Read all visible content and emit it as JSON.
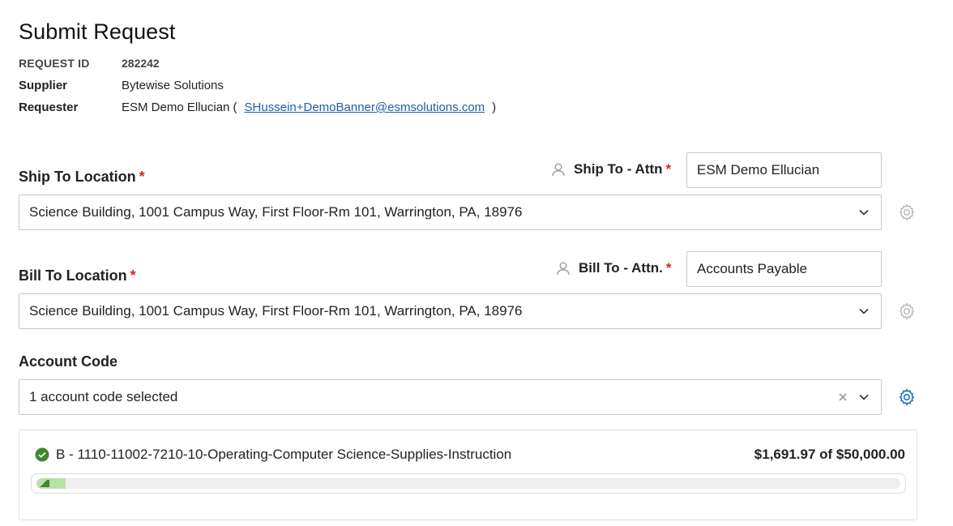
{
  "page": {
    "title": "Submit Request"
  },
  "meta": {
    "request_id_label": "REQUEST ID",
    "request_id_value": "282242",
    "supplier_label": "Supplier",
    "supplier_value": "Bytewise Solutions",
    "requester_label": "Requester",
    "requester_name_prefix": "ESM Demo Ellucian (",
    "requester_email": "SHussein+DemoBanner@esmsolutions.com",
    "requester_suffix": ")"
  },
  "ship_to": {
    "label": "Ship To Location",
    "required_mark": "*",
    "attn_label": "Ship To - Attn",
    "attn_value": "ESM Demo Ellucian",
    "location_value": "Science Building, 1001 Campus Way, First Floor-Rm 101, Warrington, PA, 18976"
  },
  "bill_to": {
    "label": "Bill To Location",
    "required_mark": "*",
    "attn_label": "Bill To - Attn.",
    "attn_value": "Accounts Payable",
    "location_value": "Science Building, 1001 Campus Way, First Floor-Rm 101, Warrington, PA, 18976"
  },
  "account_code": {
    "label": "Account Code",
    "selected_text": "1 account code selected",
    "items": [
      {
        "name": "B - 1110-11002-7210-10-Operating-Computer Science-Supplies-Instruction",
        "amount_text": "$1,691.97 of $50,000.00",
        "spent_fraction": 0.0338
      }
    ]
  },
  "colors": {
    "required": "#d9272e",
    "link": "#1f5fa8",
    "gear_active": "#1f6fb8",
    "gear_inactive": "#b5b5b5",
    "check": "#3e8a2e",
    "progress_fill": "#b9dfaa"
  },
  "icons": {
    "attn": "person-icon",
    "dropdown": "chevron-down-icon",
    "clear": "close-icon",
    "settings": "gear-icon",
    "status": "check-circle-icon"
  }
}
